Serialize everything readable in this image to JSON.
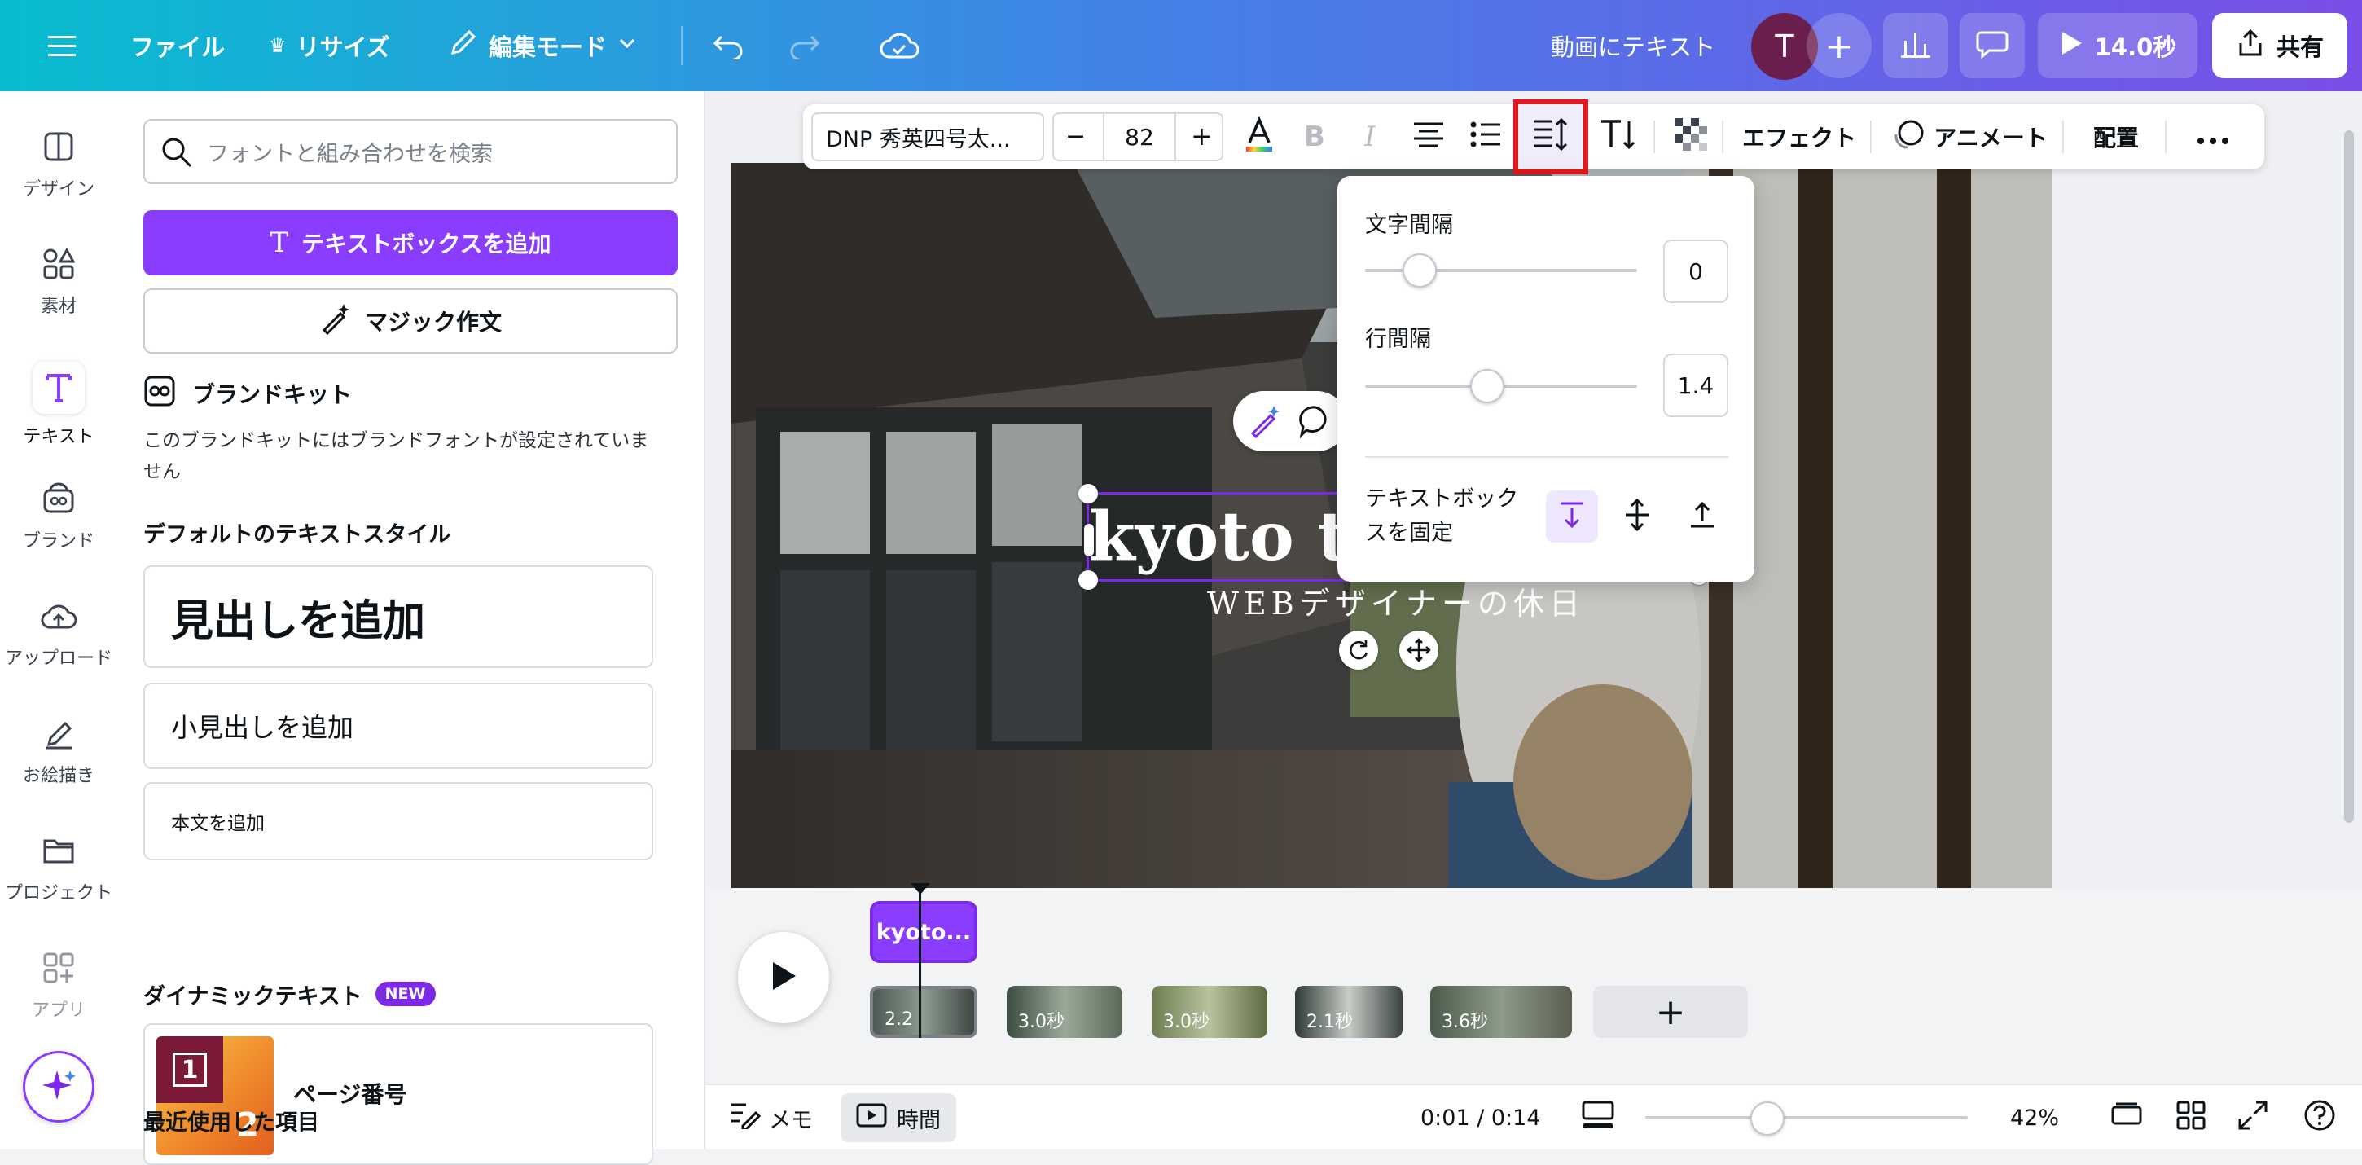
{
  "topbar": {
    "file_label": "ファイル",
    "resize_label": "リサイズ",
    "edit_mode_label": "編集モード",
    "project_title": "動画にテキスト",
    "avatar_initial": "T",
    "play_duration": "14.0秒",
    "share_label": "共有"
  },
  "rail": {
    "items": [
      {
        "label": "デザイン",
        "icon": "layout-icon"
      },
      {
        "label": "素材",
        "icon": "shapes-icon"
      },
      {
        "label": "テキスト",
        "icon": "text-icon"
      },
      {
        "label": "ブランド",
        "icon": "brand-icon"
      },
      {
        "label": "アップロード",
        "icon": "upload-cloud-icon"
      },
      {
        "label": "お絵描き",
        "icon": "pen-icon"
      },
      {
        "label": "プロジェクト",
        "icon": "folder-icon"
      },
      {
        "label": "アプリ",
        "icon": "apps-icon"
      }
    ]
  },
  "panel": {
    "search_placeholder": "フォントと組み合わせを検索",
    "add_textbox_label": "テキストボックスを追加",
    "magic_write_label": "マジック作文",
    "brand_kit_title": "ブランドキット",
    "brand_kit_note": "このブランドキットにはブランドフォントが設定されていません",
    "default_styles_title": "デフォルトのテキストスタイル",
    "heading_label": "見出しを追加",
    "subheading_label": "小見出しを追加",
    "body_label": "本文を追加",
    "dynamic_text_title": "ダイナミックテキスト",
    "new_badge": "NEW",
    "page_number_label": "ページ番号",
    "page_number_digits": [
      "1",
      "2"
    ],
    "recent_title": "最近使用した項目"
  },
  "toolbar": {
    "font_name": "DNP 秀英四号太...",
    "font_size": "82",
    "minus": "−",
    "plus": "+",
    "effects_label": "エフェクト",
    "animate_label": "アニメート",
    "position_label": "配置"
  },
  "spacing_popup": {
    "letter_spacing_label": "文字間隔",
    "letter_spacing_value": "0",
    "letter_spacing_level": 0.2,
    "line_spacing_label": "行間隔",
    "line_spacing_value": "1.4",
    "line_spacing_level": 0.45,
    "anchor_label": "テキストボックスを固定"
  },
  "canvas": {
    "headline_text": "kyoto t",
    "subtitle_text": "WEBデザイナーの休日"
  },
  "timeline": {
    "text_clip_label": "kyoto...",
    "clips": [
      "2.2",
      "3.0秒",
      "3.0秒",
      "2.1秒",
      "3.6秒"
    ]
  },
  "bottombar": {
    "notes_label": "メモ",
    "time_label": "時間",
    "timecode": "0:01 / 0:14",
    "zoom_percent": "42%",
    "zoom_level": 0.38
  },
  "colors": {
    "accent_purple": "#8b3dff",
    "highlight_red": "#e5161d",
    "selection_violet": "#7d2ae8"
  }
}
